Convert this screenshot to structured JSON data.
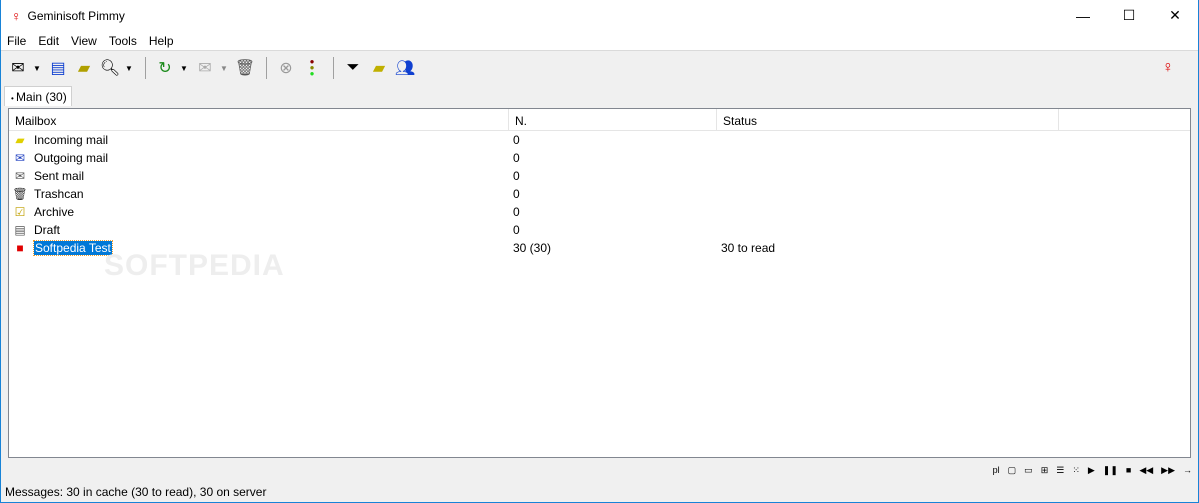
{
  "title": "Geminisoft Pimmy",
  "window_controls": {
    "minimize": "—",
    "maximize": "☐",
    "close": "✕"
  },
  "menu": [
    "File",
    "Edit",
    "View",
    "Tools",
    "Help"
  ],
  "tab": "Main (30)",
  "columns": [
    "Mailbox",
    "N.",
    "Status"
  ],
  "rows": [
    {
      "icon": "incoming-folder-icon",
      "name": "Incoming mail",
      "n": "0",
      "status": ""
    },
    {
      "icon": "outgoing-icon",
      "name": "Outgoing mail",
      "n": "0",
      "status": ""
    },
    {
      "icon": "sent-icon",
      "name": "Sent mail",
      "n": "0",
      "status": ""
    },
    {
      "icon": "trash-icon",
      "name": "Trashcan",
      "n": "0",
      "status": ""
    },
    {
      "icon": "archive-icon",
      "name": "Archive",
      "n": "0",
      "status": ""
    },
    {
      "icon": "draft-icon",
      "name": "Draft",
      "n": "0",
      "status": ""
    },
    {
      "icon": "account-icon",
      "name": "Softpedia Test",
      "n": "30 (30)",
      "status": "30 to read"
    }
  ],
  "bottom_tools": [
    "pl"
  ],
  "status_text": "Messages: 30 in cache (30 to read), 30 on server",
  "watermark": "SOFTPEDIA"
}
